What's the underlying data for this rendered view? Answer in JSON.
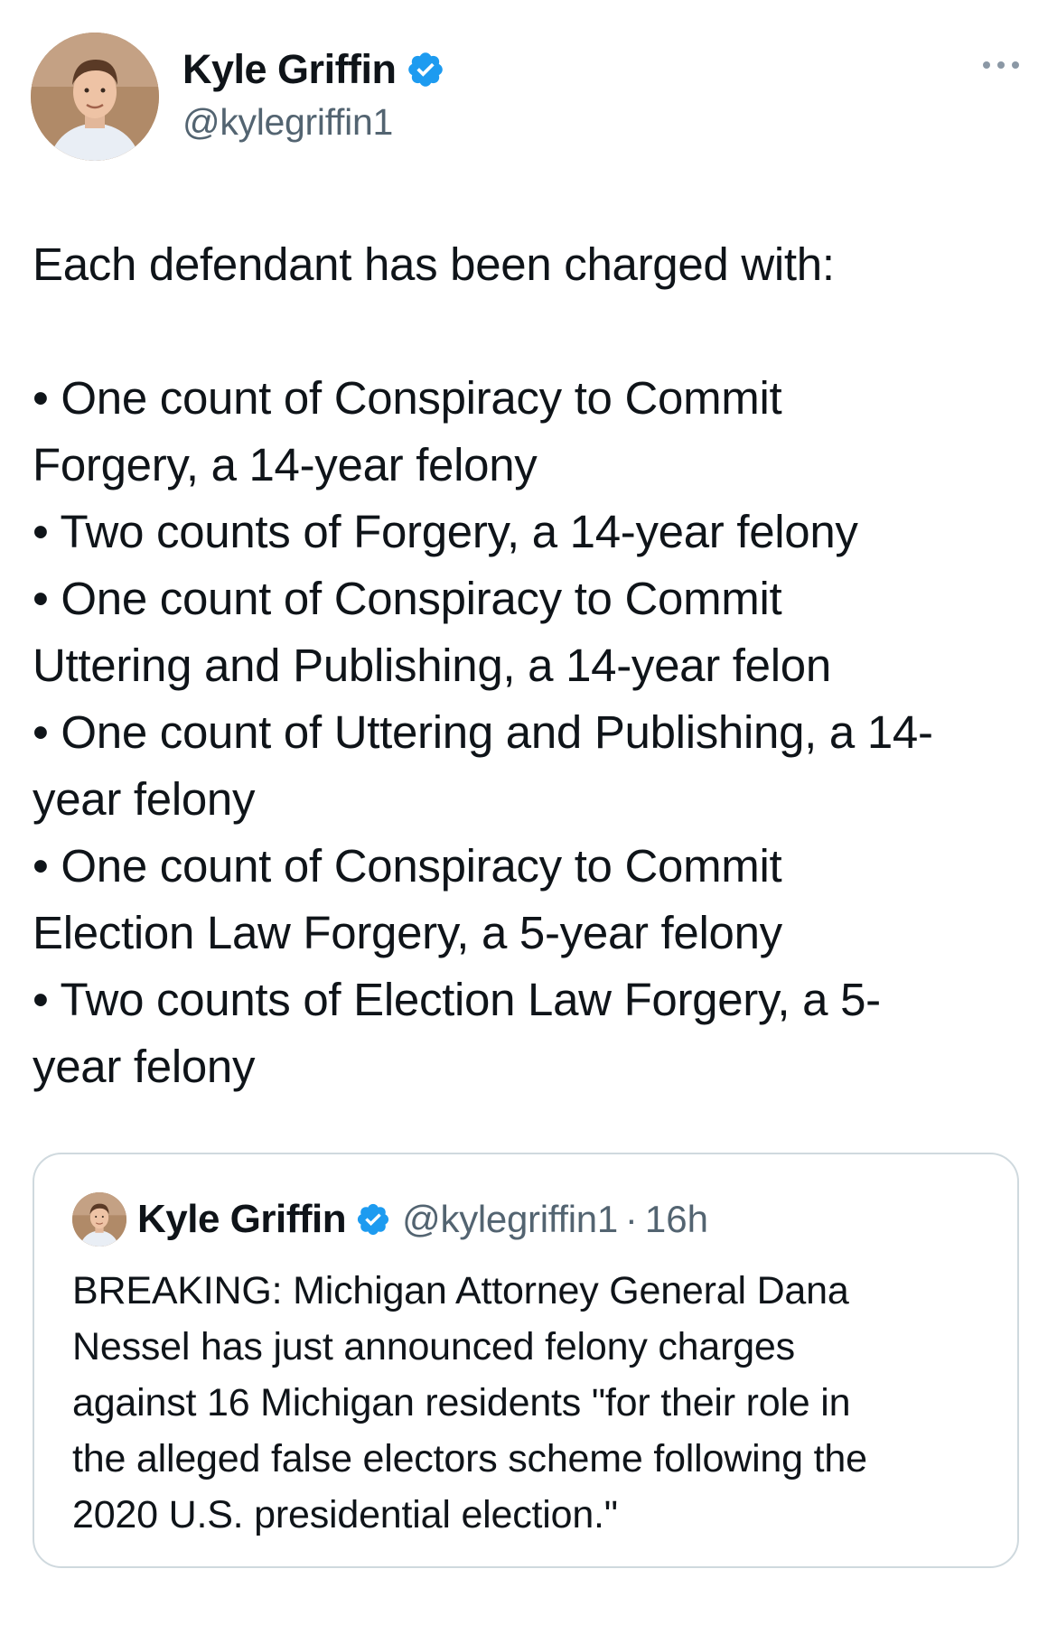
{
  "author": {
    "display_name": "Kyle Griffin",
    "handle": "@kylegriffin1",
    "verified": true,
    "avatar_icon": "profile-photo-icon"
  },
  "tweet": {
    "intro": "Each defendant has been charged with:",
    "lines": [
      "• One count of Conspiracy to Commit",
      "Forgery, a 14-year felony",
      "• Two counts of Forgery, a 14-year felony",
      "• One count of Conspiracy to Commit",
      "Uttering and Publishing, a 14-year felon",
      "• One count of Uttering and Publishing, a 14-",
      "year felony",
      "• One count of Conspiracy to Commit",
      "Election Law Forgery, a 5-year felony",
      "• Two counts of Election Law Forgery, a 5-",
      "year felony"
    ]
  },
  "quoted_tweet": {
    "display_name": "Kyle Griffin",
    "handle": "@kylegriffin1",
    "separator": "·",
    "time": "16h",
    "lines": [
      "BREAKING: Michigan Attorney General Dana",
      "Nessel has just announced felony charges",
      "against 16 Michigan residents \"for their role in",
      "the alleged false electors scheme following the",
      "2020 U.S. presidential election.\""
    ]
  },
  "colors": {
    "text_primary": "#0f1419",
    "text_secondary": "#536471",
    "verified_blue": "#1d9bf0",
    "border": "#cfd9de"
  }
}
